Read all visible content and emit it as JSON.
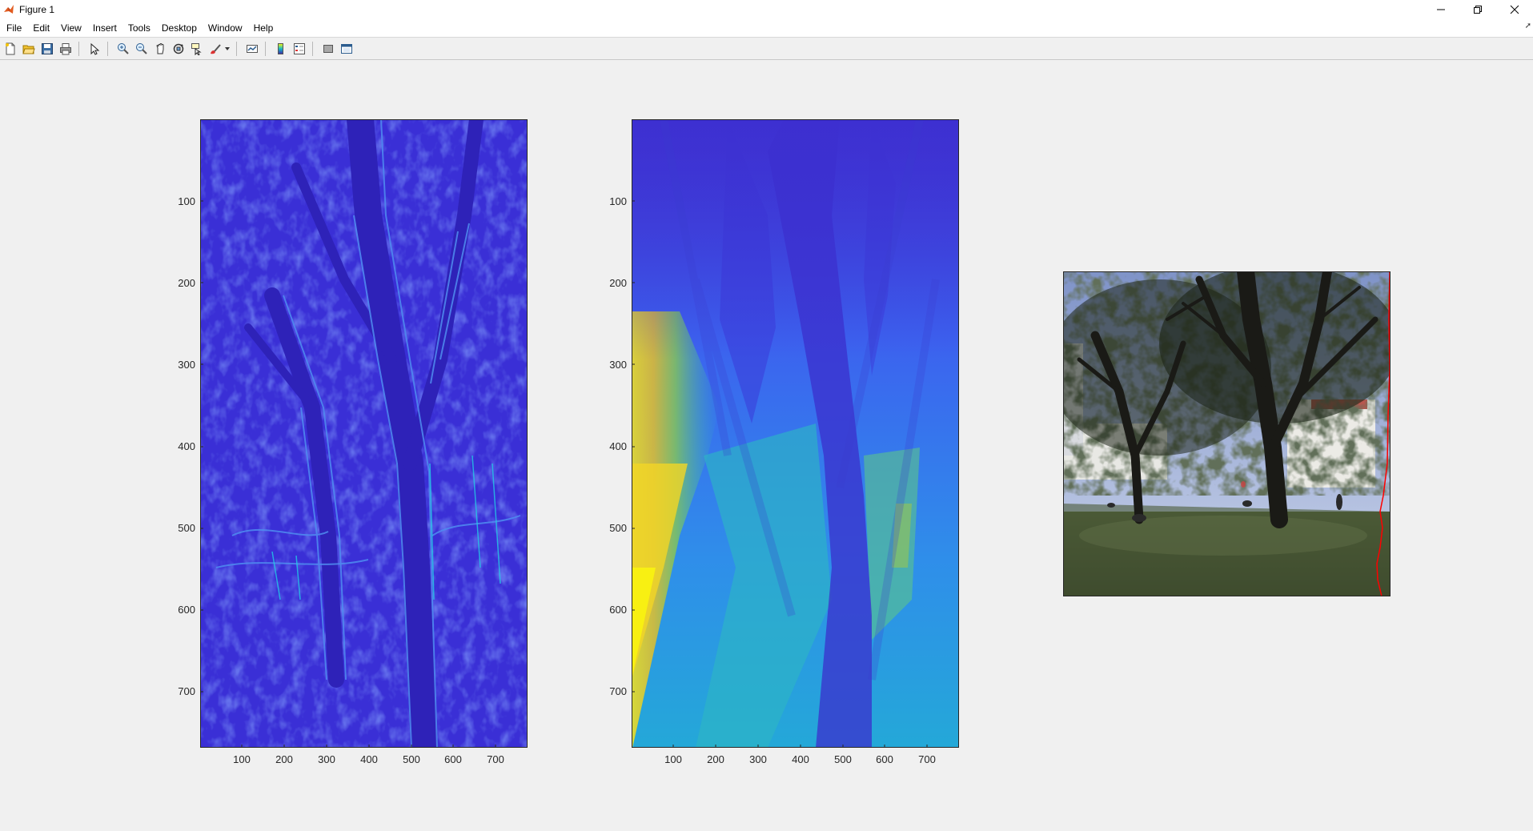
{
  "window": {
    "title": "Figure 1",
    "controls": [
      "minimize-icon",
      "restore-icon",
      "close-icon"
    ]
  },
  "menu": [
    "File",
    "Edit",
    "View",
    "Insert",
    "Tools",
    "Desktop",
    "Window",
    "Help"
  ],
  "toolbar": [
    "new-figure-icon",
    "open-file-icon",
    "save-icon",
    "print-icon",
    "edit-plot-icon",
    "zoom-in-icon",
    "zoom-out-icon",
    "pan-icon",
    "rotate-3d-icon",
    "data-cursor-icon",
    "brush-icon",
    "link-plot-icon",
    "colorbar-icon",
    "legend-icon",
    "hide-plot-tools-icon",
    "show-plot-tools-icon"
  ],
  "axes": [
    {
      "name": "gradient-energy-map",
      "colormap": "parula",
      "yticks": [
        "100",
        "200",
        "300",
        "400",
        "500",
        "600",
        "700"
      ],
      "xticks": [
        "100",
        "200",
        "300",
        "400",
        "500",
        "600",
        "700"
      ]
    },
    {
      "name": "cumulative-energy-map",
      "colormap": "parula",
      "yticks": [
        "100",
        "200",
        "300",
        "400",
        "500",
        "600",
        "700"
      ],
      "xticks": [
        "100",
        "200",
        "300",
        "400",
        "500",
        "600",
        "700"
      ]
    },
    {
      "name": "photo-with-seam",
      "seam_color": "#ff0000"
    }
  ],
  "colors": {
    "background": "#f0f0f0",
    "parula_low": "#3e26a8",
    "parula_mid": "#16b9c7",
    "parula_high": "#f9fb0e"
  }
}
